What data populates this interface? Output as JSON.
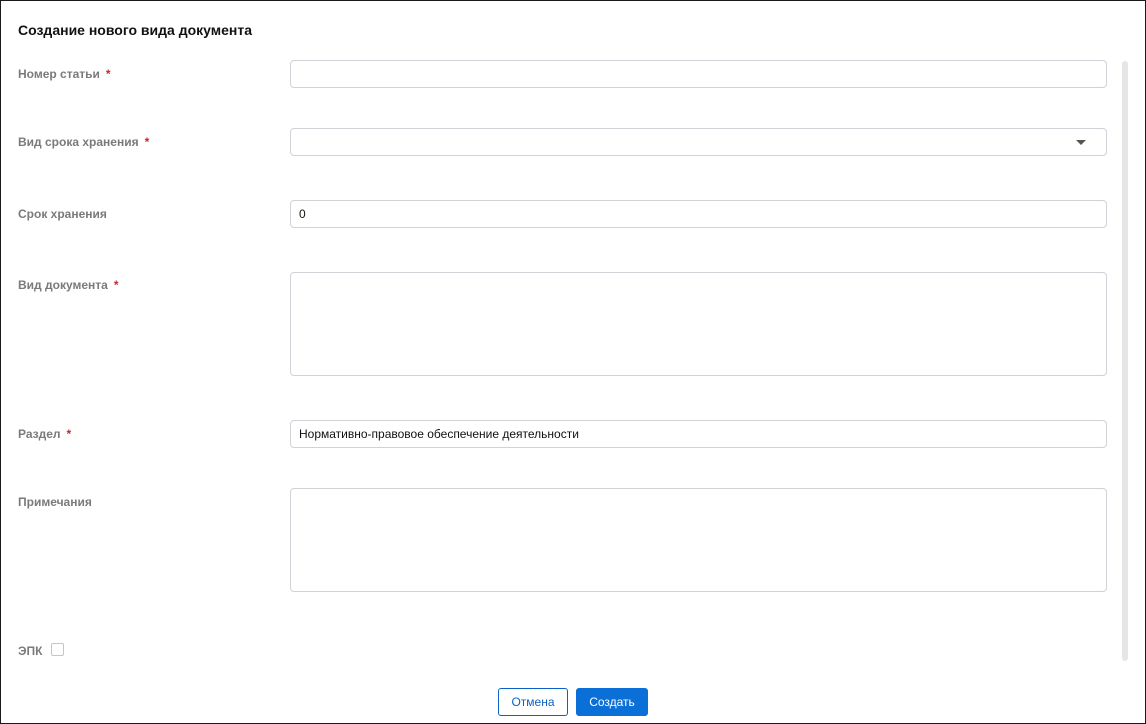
{
  "dialog": {
    "title": "Создание нового вида документа",
    "fields": {
      "article_number": {
        "label": "Номер статьи",
        "required_mark": "*",
        "value": ""
      },
      "storage_period_type": {
        "label": "Вид срока хранения",
        "required_mark": "*",
        "value": ""
      },
      "storage_period": {
        "label": "Срок хранения",
        "value": "0"
      },
      "document_type": {
        "label": "Вид документа",
        "required_mark": "*",
        "value": ""
      },
      "section": {
        "label": "Раздел",
        "required_mark": "*",
        "value": "Нормативно-правовое обеспечение деятельности"
      },
      "notes": {
        "label": "Примечания",
        "value": ""
      },
      "epk": {
        "label": "ЭПК",
        "checked": false
      }
    },
    "buttons": {
      "cancel": "Отмена",
      "create": "Создать"
    }
  },
  "colors": {
    "accent": "#0b6fd8",
    "required": "#c62828",
    "label": "#7a7a7a"
  }
}
